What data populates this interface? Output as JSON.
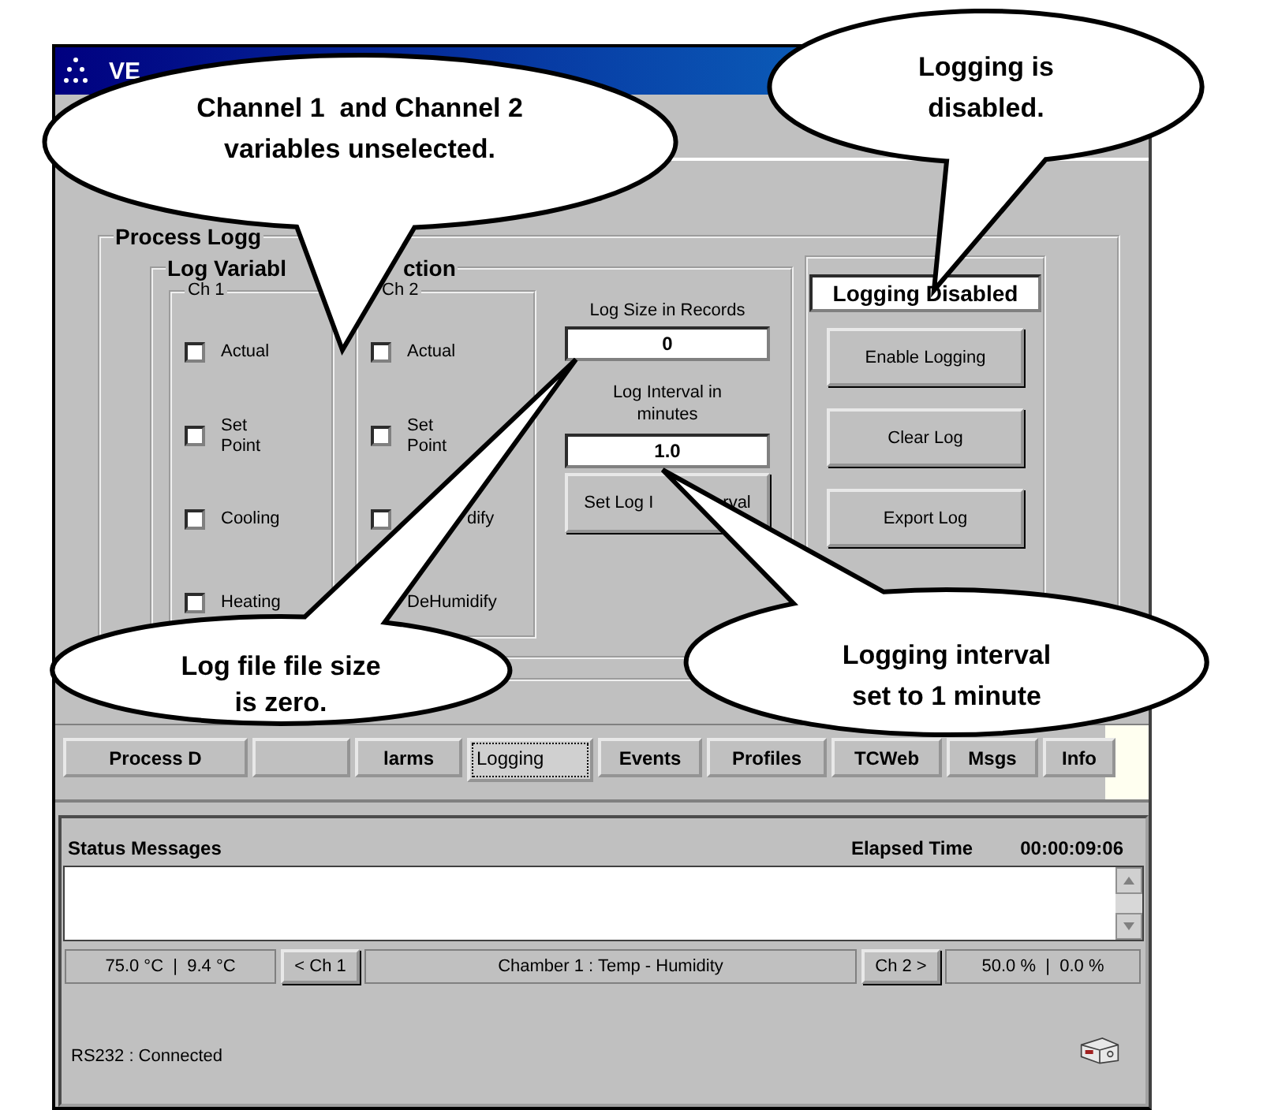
{
  "window": {
    "title": "VE"
  },
  "process_logging": {
    "title": "Process Logg",
    "selection_title": [
      "Log Variabl",
      "ction"
    ],
    "channels": [
      {
        "title": "Ch 1",
        "items": [
          {
            "label": "Actual",
            "checked": false
          },
          {
            "label": "Set Point",
            "checked": false
          },
          {
            "label": "Cooling",
            "checked": false
          },
          {
            "label": "Heating",
            "checked": false
          }
        ]
      },
      {
        "title": "Ch 2",
        "items": [
          {
            "label": "Actual",
            "checked": false
          },
          {
            "label": "Set Point",
            "checked": false
          },
          {
            "label": "dify",
            "checked": false,
            "covered_start": true
          },
          {
            "label": "DeHumidify"
          }
        ]
      }
    ],
    "log_size_label": "Log Size in Records",
    "log_size": "0",
    "interval_label": "Log Interval in minutes",
    "interval": "1.0",
    "set_interval_button": [
      "Set Log I",
      "rval"
    ],
    "logging_status": "Logging Disabled",
    "buttons": [
      "Enable Logging",
      "Clear Log",
      "Export Log"
    ]
  },
  "tabs": [
    {
      "label": "Process D",
      "selected": false
    },
    {
      "selected": false
    },
    {
      "label": "larms",
      "selected": false
    },
    {
      "label": "Logging",
      "selected": true
    },
    {
      "label": "Events",
      "selected": false
    },
    {
      "label": "Profiles",
      "selected": false
    },
    {
      "label": "TCWeb",
      "selected": false
    },
    {
      "label": "Msgs",
      "selected": false
    },
    {
      "label": "Info",
      "selected": false
    }
  ],
  "status": {
    "title": "Status Messages",
    "elapsed_label": "Elapsed Time",
    "elapsed": "00:00:09:06",
    "readout_left": "75.0 °C  |  9.4 °C",
    "prev_button": "< Ch 1",
    "chamber": "Chamber 1 : Temp - Humidity",
    "next_button": "Ch 2 >",
    "readout_right": "50.0 %  |  0.0 %",
    "connection": "RS232 : Connected"
  },
  "callouts": [
    {
      "text": "Channel 1  and Channel 2\nvariables unselected."
    },
    {
      "text": "Logging is\ndisabled."
    },
    {
      "text": "Log file file size\nis zero."
    },
    {
      "text": "Logging interval\nset to 1 minute"
    }
  ]
}
